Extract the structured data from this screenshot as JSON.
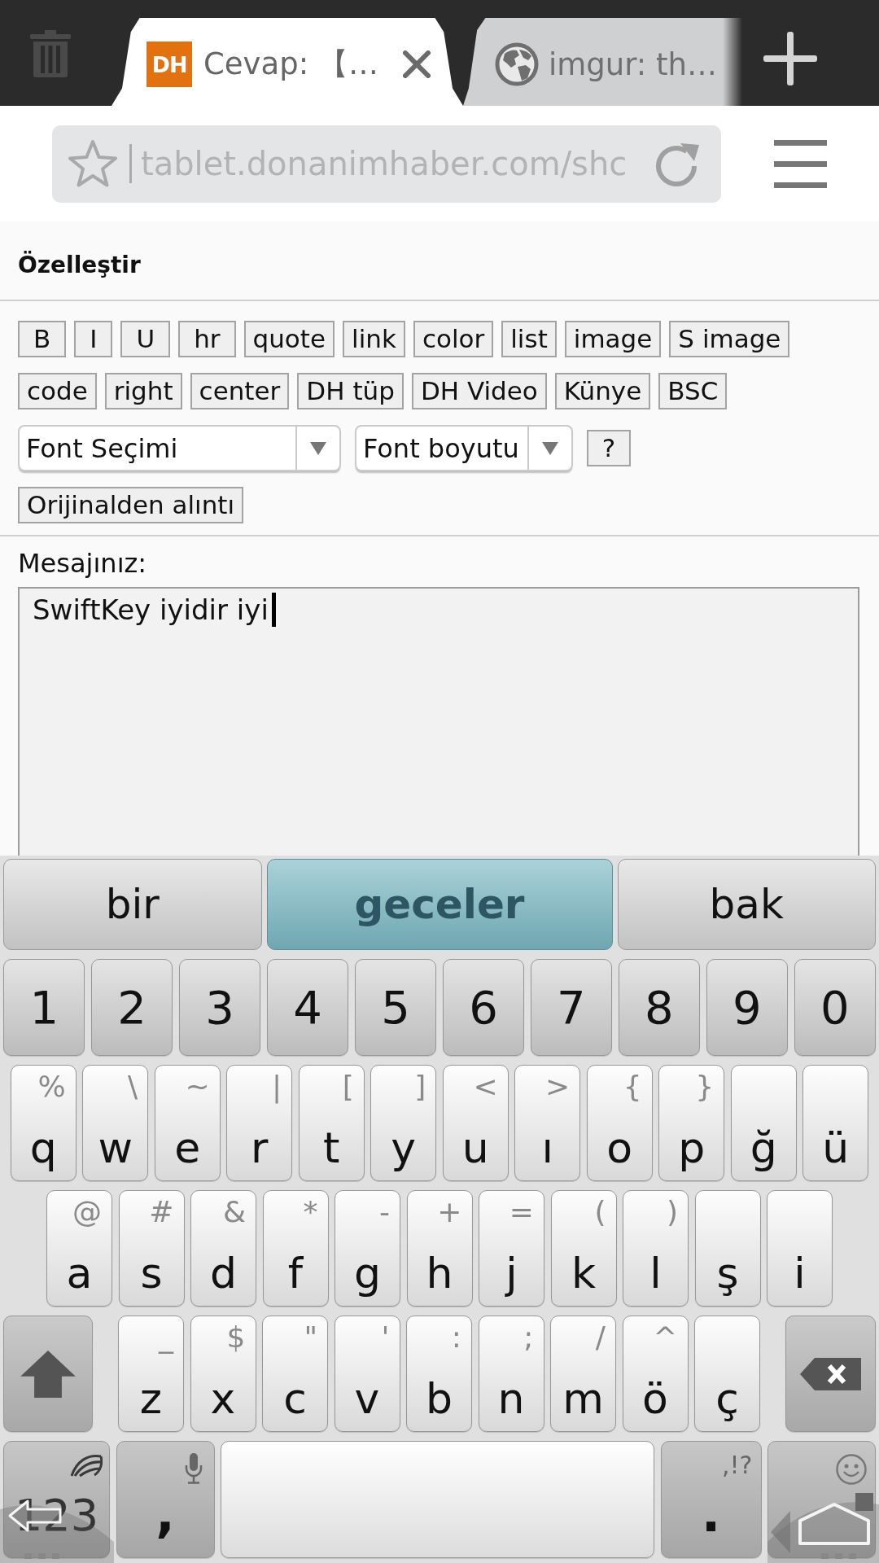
{
  "browser": {
    "tabs": [
      {
        "title": "Cevap: 【…",
        "favicon": {
          "kind": "text",
          "text": "DH"
        },
        "selected": true
      },
      {
        "title": "imgur: th…",
        "favicon": {
          "kind": "globe"
        },
        "selected": false
      }
    ],
    "address_bar": {
      "url": "tablet.donanimhaber.com/shc"
    }
  },
  "editor": {
    "heading": "Özelleştir",
    "toolbar_rows": [
      {
        "items": [
          {
            "kind": "button",
            "label": "B"
          },
          {
            "kind": "button",
            "label": "I"
          },
          {
            "kind": "button",
            "label": "U"
          },
          {
            "kind": "button",
            "label": "hr"
          },
          {
            "kind": "button",
            "label": "quote"
          },
          {
            "kind": "button",
            "label": "link"
          },
          {
            "kind": "button",
            "label": "color"
          },
          {
            "kind": "button",
            "label": "list"
          },
          {
            "kind": "button",
            "label": "image"
          },
          {
            "kind": "button",
            "label": "S image"
          }
        ]
      },
      {
        "items": [
          {
            "kind": "button",
            "label": "code"
          },
          {
            "kind": "button",
            "label": "right"
          },
          {
            "kind": "button",
            "label": "center"
          },
          {
            "kind": "button",
            "label": "DH tüp"
          },
          {
            "kind": "button",
            "label": "DH Video"
          },
          {
            "kind": "button",
            "label": "Künye"
          },
          {
            "kind": "button",
            "label": "BSC"
          }
        ]
      },
      {
        "items": [
          {
            "kind": "select",
            "value": "Font Seçimi"
          },
          {
            "kind": "select",
            "value": "Font boyutu"
          },
          {
            "kind": "button",
            "label": "?"
          }
        ]
      },
      {
        "items": [
          {
            "kind": "button",
            "label": "Orijinalden alıntı"
          }
        ]
      }
    ],
    "message_label": "Mesajınız:",
    "message": {
      "value": "SwiftKey iyidir iyi"
    }
  },
  "keyboard": {
    "suggestions": [
      {
        "text": "bir",
        "selected": false
      },
      {
        "text": "geceler",
        "selected": true
      },
      {
        "text": "bak",
        "selected": false
      }
    ],
    "rows": [
      {
        "keys": [
          {
            "kind": "digit",
            "label": "1"
          },
          {
            "kind": "digit",
            "label": "2"
          },
          {
            "kind": "digit",
            "label": "3"
          },
          {
            "kind": "digit",
            "label": "4"
          },
          {
            "kind": "digit",
            "label": "5"
          },
          {
            "kind": "digit",
            "label": "6"
          },
          {
            "kind": "digit",
            "label": "7"
          },
          {
            "kind": "digit",
            "label": "8"
          },
          {
            "kind": "digit",
            "label": "9"
          },
          {
            "kind": "digit",
            "label": "0"
          }
        ]
      },
      {
        "keys": [
          {
            "kind": "letter",
            "label": "q",
            "hint": "%"
          },
          {
            "kind": "letter",
            "label": "w",
            "hint": "\\"
          },
          {
            "kind": "letter",
            "label": "e",
            "hint": "~"
          },
          {
            "kind": "letter",
            "label": "r",
            "hint": "|"
          },
          {
            "kind": "letter",
            "label": "t",
            "hint": "["
          },
          {
            "kind": "letter",
            "label": "y",
            "hint": "]"
          },
          {
            "kind": "letter",
            "label": "u",
            "hint": "<"
          },
          {
            "kind": "letter",
            "label": "ı",
            "hint": ">"
          },
          {
            "kind": "letter",
            "label": "o",
            "hint": "{"
          },
          {
            "kind": "letter",
            "label": "p",
            "hint": "}"
          },
          {
            "kind": "letter",
            "label": "ğ"
          },
          {
            "kind": "letter",
            "label": "ü"
          }
        ]
      },
      {
        "keys": [
          {
            "kind": "letter",
            "label": "a",
            "hint": "@"
          },
          {
            "kind": "letter",
            "label": "s",
            "hint": "#"
          },
          {
            "kind": "letter",
            "label": "d",
            "hint": "&"
          },
          {
            "kind": "letter",
            "label": "f",
            "hint": "*"
          },
          {
            "kind": "letter",
            "label": "g",
            "hint": "-"
          },
          {
            "kind": "letter",
            "label": "h",
            "hint": "+"
          },
          {
            "kind": "letter",
            "label": "j",
            "hint": "="
          },
          {
            "kind": "letter",
            "label": "k",
            "hint": "("
          },
          {
            "kind": "letter",
            "label": "l",
            "hint": ")"
          },
          {
            "kind": "letter",
            "label": "ş"
          },
          {
            "kind": "letter",
            "label": "i"
          }
        ]
      },
      {
        "keys": [
          {
            "kind": "shift"
          },
          {
            "kind": "letter",
            "label": "z",
            "hint": "_"
          },
          {
            "kind": "letter",
            "label": "x",
            "hint": "$"
          },
          {
            "kind": "letter",
            "label": "c",
            "hint": "\""
          },
          {
            "kind": "letter",
            "label": "v",
            "hint": "'"
          },
          {
            "kind": "letter",
            "label": "b",
            "hint": ":"
          },
          {
            "kind": "letter",
            "label": "n",
            "hint": ";"
          },
          {
            "kind": "letter",
            "label": "m",
            "hint": "/"
          },
          {
            "kind": "letter",
            "label": "ö",
            "hint": "^"
          },
          {
            "kind": "letter",
            "label": "ç"
          },
          {
            "kind": "backspace"
          }
        ]
      },
      {
        "keys": [
          {
            "kind": "mode",
            "label": "123"
          },
          {
            "kind": "voice",
            "label": ","
          },
          {
            "kind": "space"
          },
          {
            "kind": "punct",
            "label": ".",
            "hint": ",!?"
          },
          {
            "kind": "emoji"
          }
        ]
      }
    ]
  }
}
